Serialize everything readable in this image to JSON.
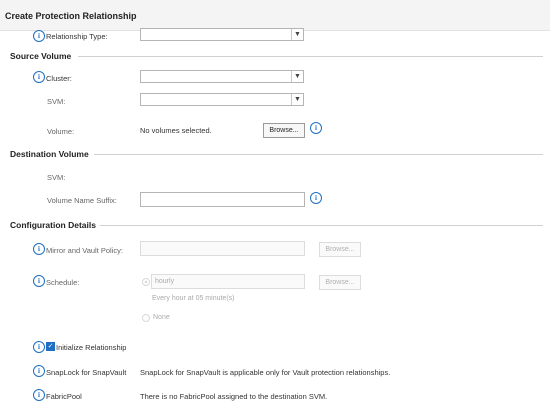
{
  "dialog": {
    "title": "Create Protection Relationship"
  },
  "relationship": {
    "type_label": "Relationship Type:",
    "type_value": ""
  },
  "source": {
    "heading": "Source Volume",
    "cluster_label": "Cluster:",
    "svm_label": "SVM:",
    "volume_label": "Volume:",
    "volume_value": "No volumes selected.",
    "browse_label": "Browse..."
  },
  "destination": {
    "heading": "Destination Volume",
    "svm_label": "SVM:",
    "suffix_label": "Volume Name Suffix:",
    "suffix_value": ""
  },
  "config": {
    "heading": "Configuration Details",
    "policy_label": "Mirror and Vault Policy:",
    "policy_browse": "Browse...",
    "schedule_label": "Schedule:",
    "schedule_value": "hourly",
    "schedule_browse": "Browse...",
    "schedule_hint": "Every hour at 05 minute(s)",
    "none_label": "None",
    "init_label": "Initialize Relationship",
    "snaplock_label": "SnapLock for SnapVault",
    "snaplock_text": "SnapLock for SnapVault is applicable only for Vault protection relationships.",
    "fabricpool_label": "FabricPool",
    "fabricpool_text": "There is no FabricPool assigned to the destination SVM."
  },
  "icons": {
    "info": "info-icon",
    "dropdown": "chevron-down-icon",
    "check": "checkmark-icon"
  },
  "colors": {
    "accent": "#1f6fc4",
    "title_bg": "#f4f4f4"
  }
}
